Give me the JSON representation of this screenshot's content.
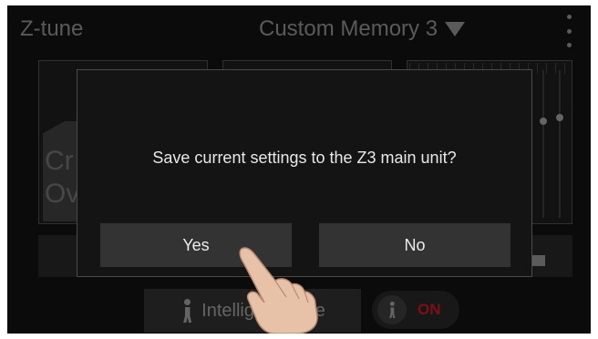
{
  "header": {
    "app_title": "Z-tune",
    "memory_selector": "Custom Memory 3"
  },
  "panels": {
    "crossover_label": "Cr\nOv"
  },
  "bottom": {
    "intelligent_tune_label": "Intelligent Tune",
    "toggle_label": "ON"
  },
  "dialog": {
    "message": "Save current settings to the Z3 main unit?",
    "yes_label": "Yes",
    "no_label": "No"
  },
  "colors": {
    "background": "#111111",
    "header_text": "#8a8a8a",
    "button": "#333333",
    "toggle_on": "#c0191f"
  },
  "icons": [
    "dropdown-triangle-icon",
    "kebab-menu-icon",
    "person-icon",
    "pointing-hand-icon"
  ]
}
